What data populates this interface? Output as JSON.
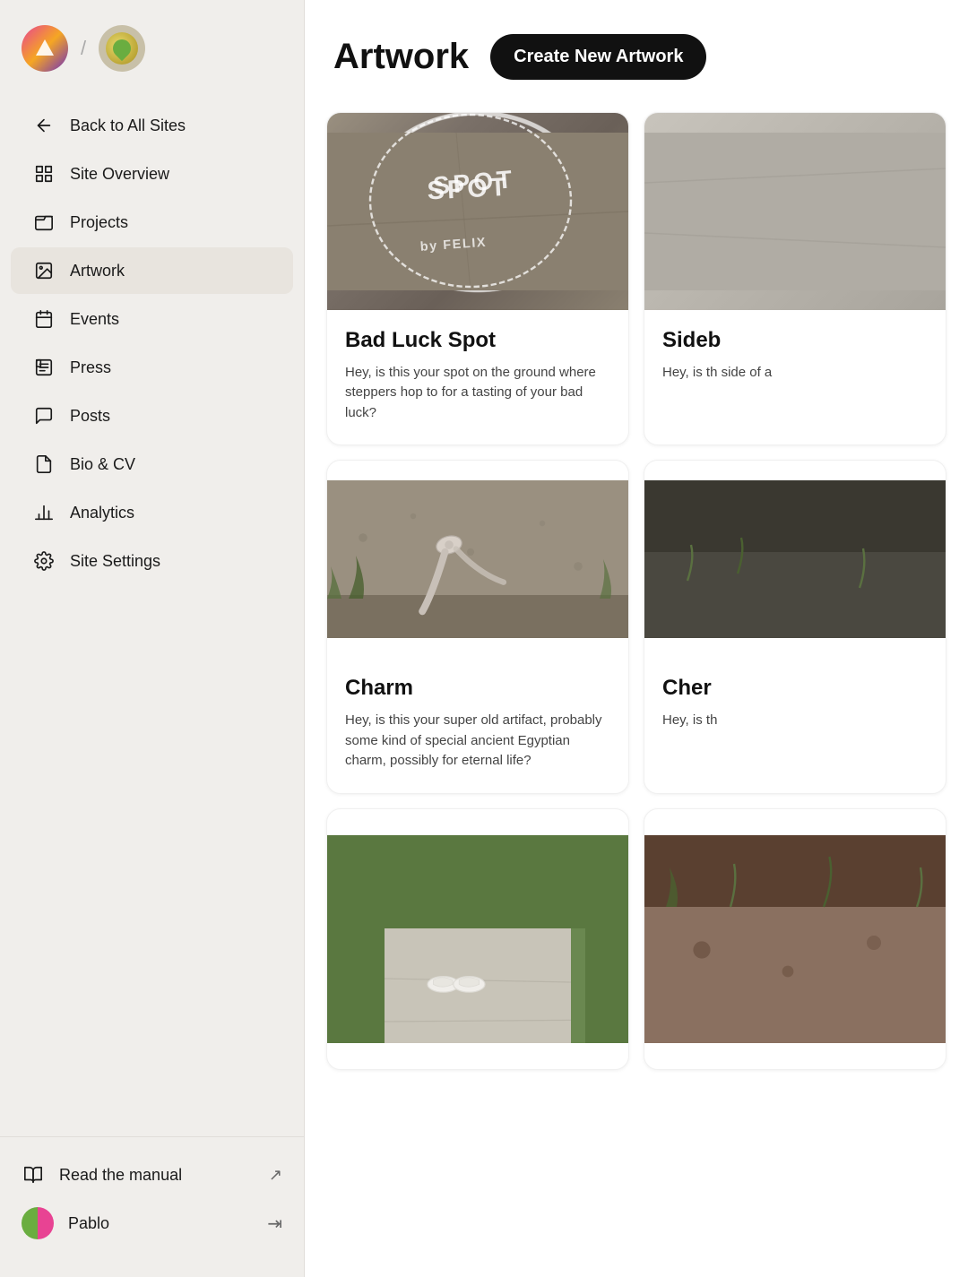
{
  "sidebar": {
    "back_label": "Back to All Sites",
    "nav_items": [
      {
        "id": "site-overview",
        "label": "Site Overview",
        "icon": "grid"
      },
      {
        "id": "projects",
        "label": "Projects",
        "icon": "folder"
      },
      {
        "id": "artwork",
        "label": "Artwork",
        "icon": "image",
        "active": true
      },
      {
        "id": "events",
        "label": "Events",
        "icon": "calendar"
      },
      {
        "id": "press",
        "label": "Press",
        "icon": "newspaper"
      },
      {
        "id": "posts",
        "label": "Posts",
        "icon": "message"
      },
      {
        "id": "bio-cv",
        "label": "Bio & CV",
        "icon": "file"
      },
      {
        "id": "analytics",
        "label": "Analytics",
        "icon": "bar-chart"
      },
      {
        "id": "site-settings",
        "label": "Site Settings",
        "icon": "settings"
      }
    ],
    "read_manual_label": "Read the manual",
    "user_name": "Pablo",
    "logout_icon": "→"
  },
  "main": {
    "page_title": "Artwork",
    "create_button": "Create New Artwork",
    "artwork_cards": [
      {
        "id": "bad-luck-spot",
        "title": "Bad Luck Spot",
        "description": "Hey, is this your spot on the ground where steppers hop to for a tasting of your bad luck?",
        "image_type": "chalk"
      },
      {
        "id": "sideb",
        "title": "Sideb",
        "description": "Hey, is th side of a",
        "image_type": "gray",
        "partial": true
      },
      {
        "id": "charm",
        "title": "Charm",
        "description": "Hey, is this your super old artifact, probably some kind of special ancient Egyptian charm, possibly for eternal life?",
        "image_type": "ribbon"
      },
      {
        "id": "cher",
        "title": "Cher",
        "description": "Hey, is th",
        "image_type": "gray-dark",
        "partial": true
      },
      {
        "id": "slippers",
        "title": "",
        "description": "",
        "image_type": "slippers"
      },
      {
        "id": "unknown",
        "title": "",
        "description": "",
        "image_type": "dirt",
        "partial": true
      }
    ]
  }
}
